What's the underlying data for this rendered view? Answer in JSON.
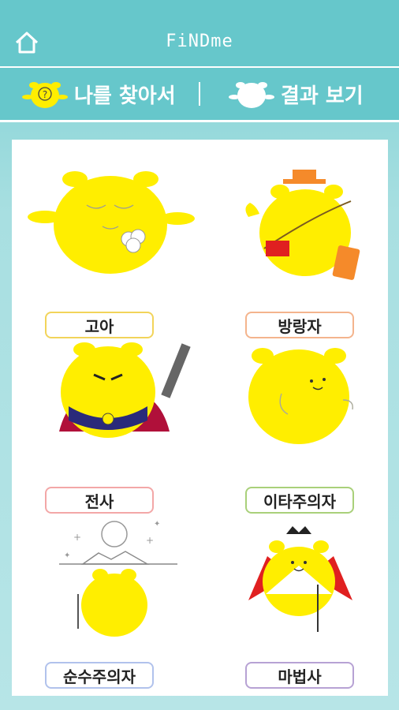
{
  "header": {
    "title": "FiNDme"
  },
  "tabs": [
    {
      "label": "나를 찾아서"
    },
    {
      "label": "결과 보기"
    }
  ],
  "characters": [
    {
      "label": "고아",
      "border": "#f2d45a"
    },
    {
      "label": "방랑자",
      "border": "#f4b48d"
    },
    {
      "label": "전사",
      "border": "#f3a7a7"
    },
    {
      "label": "이타주의자",
      "border": "#a9d07a"
    },
    {
      "label": "순수주의자",
      "border": "#b1c2ec"
    },
    {
      "label": "마법사",
      "border": "#b7a2d4"
    }
  ],
  "colors": {
    "accent": "#66c7cb",
    "character": "#ffee00"
  }
}
